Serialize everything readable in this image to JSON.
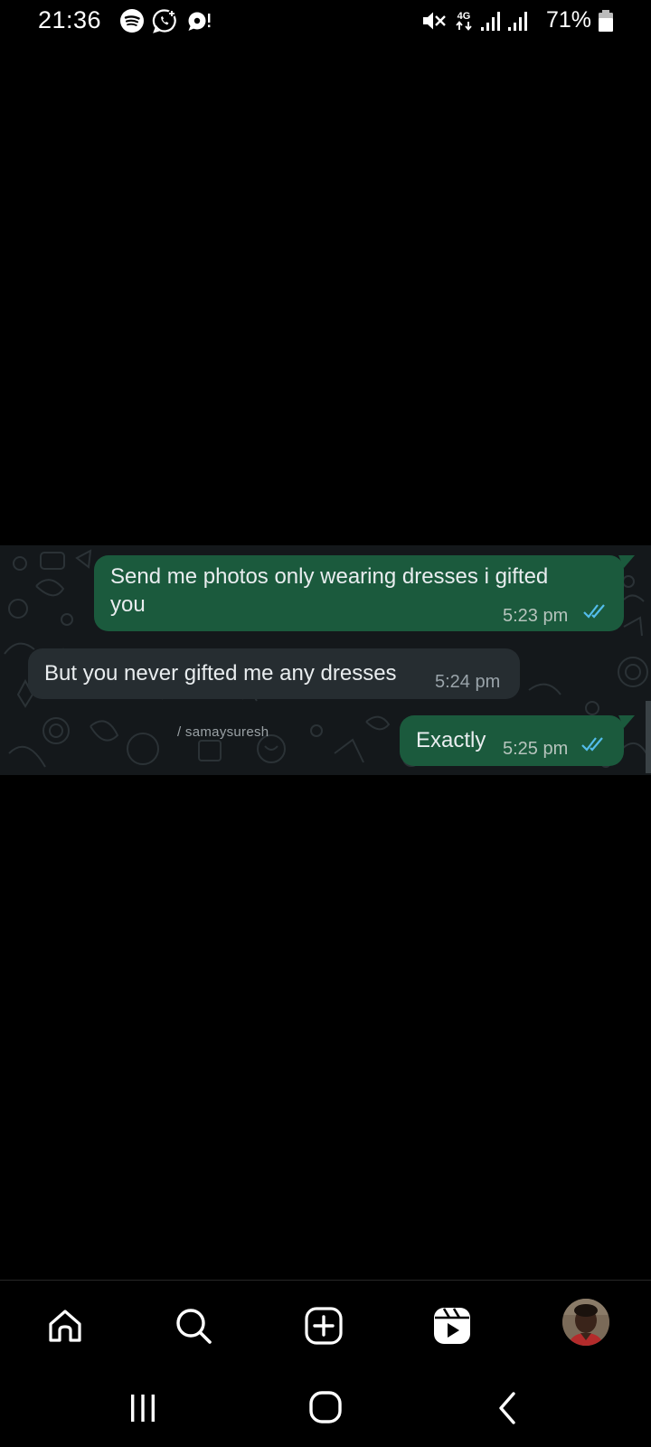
{
  "status_bar": {
    "time": "21:36",
    "left_icons": [
      "spotify-icon",
      "whatsapp-status-icon",
      "chat-alert-icon"
    ],
    "right_icons": [
      "mute-icon",
      "network-4g-icon",
      "signal-icon",
      "signal-icon",
      "battery-icon"
    ],
    "network": "4G",
    "battery_percent": "71%"
  },
  "chat": {
    "messages": [
      {
        "direction": "outgoing",
        "line1": "Send me photos only wearing dresses i gifted",
        "line2": "you",
        "time": "5:23 pm",
        "status": "read"
      },
      {
        "direction": "incoming",
        "line1": "But you never gifted me any dresses",
        "time": "5:24 pm"
      },
      {
        "direction": "outgoing",
        "line1": "Exactly",
        "time": "5:25 pm",
        "status": "read"
      }
    ],
    "watermark": "/ samaysuresh",
    "colors": {
      "background": "#14181b",
      "outgoing_bubble": "#1b5a3d",
      "incoming_bubble": "#262d31",
      "read_ticks": "#53bdeb"
    }
  },
  "bottom_nav": {
    "items": [
      "home-icon",
      "search-icon",
      "create-post-icon",
      "reels-icon",
      "profile-avatar"
    ]
  },
  "system_nav": {
    "items": [
      "recent-apps-icon",
      "home-button-icon",
      "back-icon"
    ]
  }
}
